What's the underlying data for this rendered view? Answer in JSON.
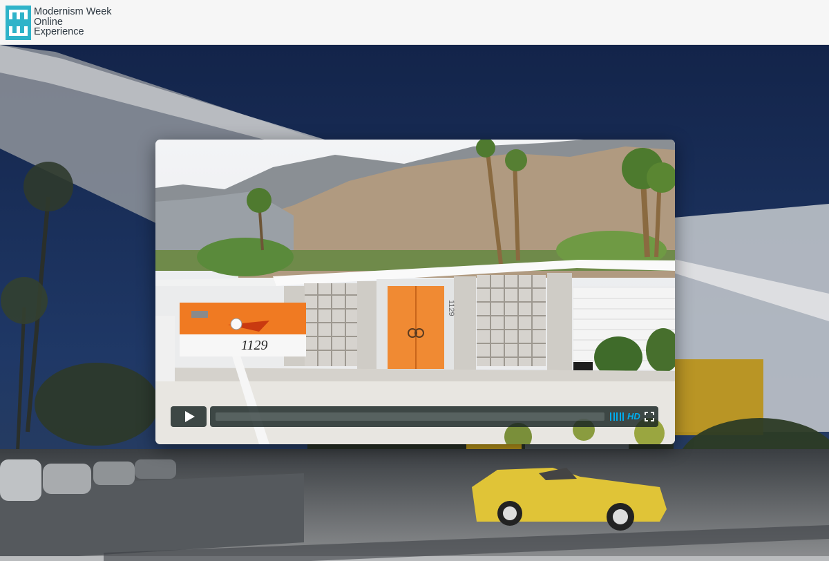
{
  "brand": {
    "name_lines": [
      "Modernism Week",
      "Online",
      "Experience"
    ],
    "logo_color": "#2fb3c9",
    "logo_icon": "mw-logo-icon"
  },
  "video": {
    "mailbox_number": "1129",
    "door_number": "1129",
    "controls": {
      "play_icon": "play-icon",
      "progress_fraction": 0.0,
      "accent_color": "#00adef",
      "volume_icon": "volume-bars-icon",
      "hd_label": "HD",
      "fullscreen_icon": "fullscreen-icon"
    }
  }
}
